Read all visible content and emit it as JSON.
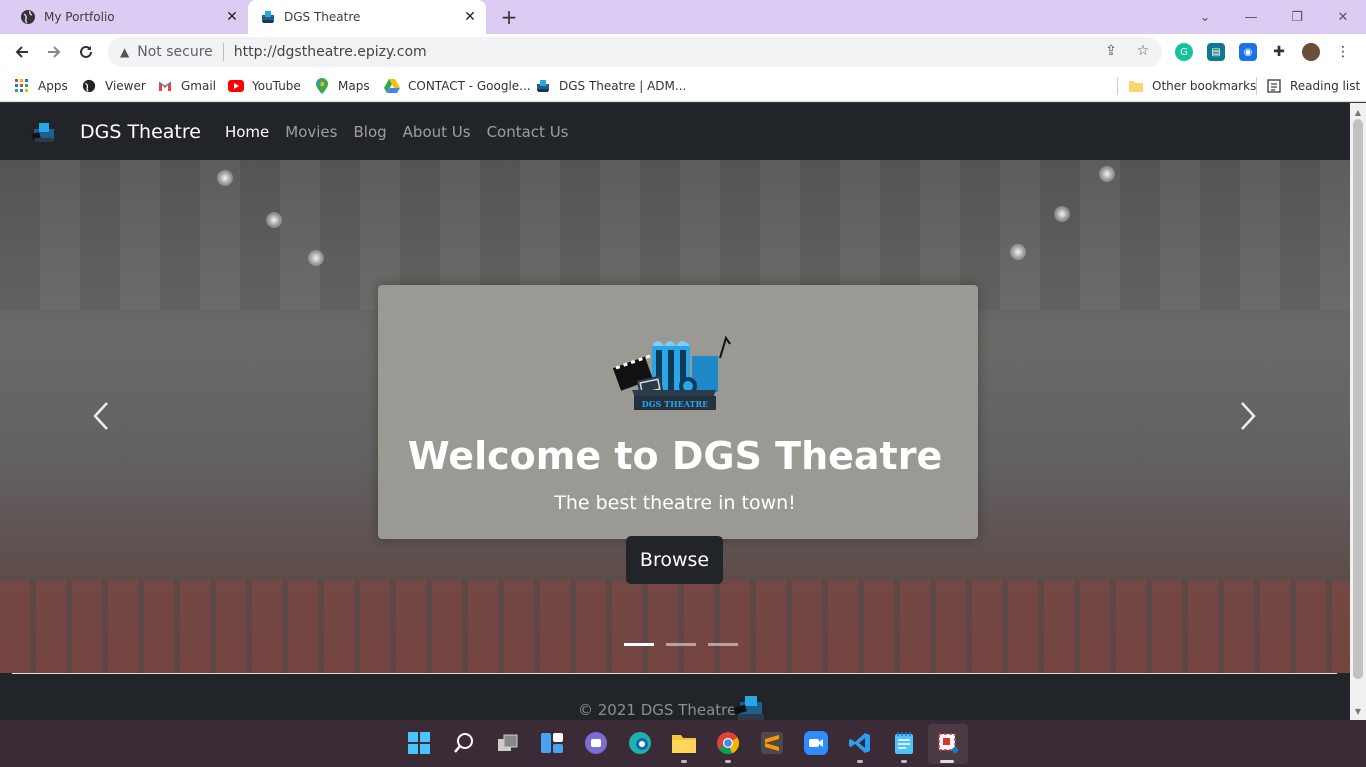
{
  "tabs": [
    {
      "title": "My Portfolio",
      "active": false,
      "icon": "globe-icon"
    },
    {
      "title": "DGS Theatre",
      "active": true,
      "icon": "dgs-logo-icon"
    }
  ],
  "omnibox": {
    "security": "Not secure",
    "url": "http://dgstheatre.epizy.com"
  },
  "bookmarks": [
    {
      "label": "Apps",
      "icon": "apps-grid-icon"
    },
    {
      "label": "Viewer",
      "icon": "globe-icon"
    },
    {
      "label": "Gmail",
      "icon": "gmail-icon"
    },
    {
      "label": "YouTube",
      "icon": "youtube-icon"
    },
    {
      "label": "Maps",
      "icon": "maps-icon"
    },
    {
      "label": "CONTACT - Google...",
      "icon": "google-drive-icon"
    },
    {
      "label": "DGS Theatre | ADM...",
      "icon": "dgs-logo-icon"
    },
    {
      "label": "Other bookmarks",
      "icon": "folder-icon"
    },
    {
      "label": "Reading list",
      "icon": "reading-list-icon"
    }
  ],
  "navbar": {
    "brand": "DGS Theatre",
    "links": [
      "Home",
      "Movies",
      "Blog",
      "About Us",
      "Contact Us"
    ],
    "active": "Home"
  },
  "hero": {
    "logo_text": "DGS THEATRE",
    "title": "Welcome to DGS Theatre",
    "subtitle": "The best theatre in town!",
    "button": "Browse",
    "slides": 3,
    "active_slide": 1
  },
  "footer": {
    "copyright": "© 2021 DGS Theatre"
  },
  "colors": {
    "tabstrip": "#dccbf2",
    "navbar": "#212529",
    "taskbar": "#3b2b36",
    "logo_blue": "#29a6e8"
  }
}
